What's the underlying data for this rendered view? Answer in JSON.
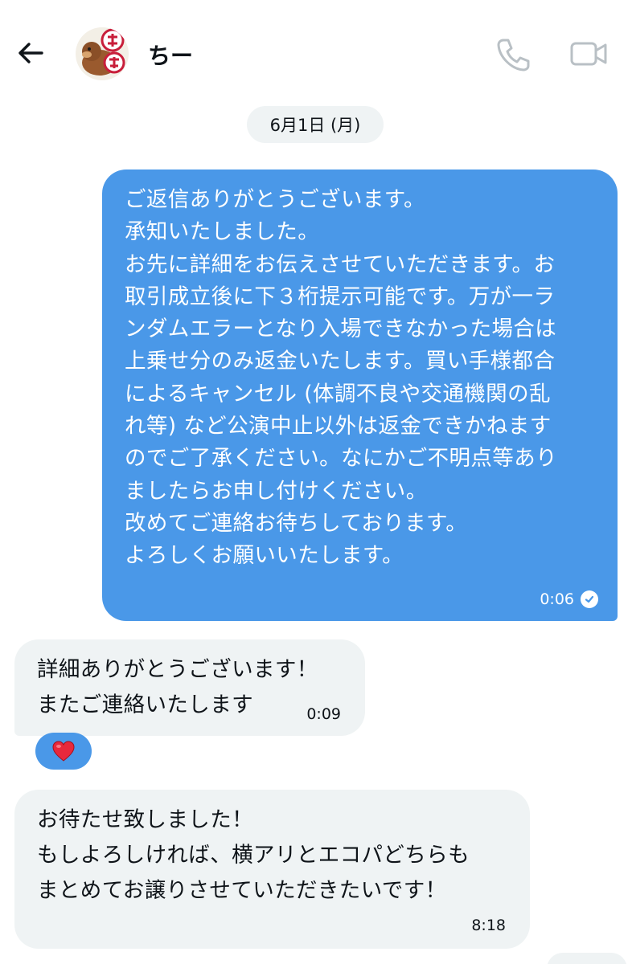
{
  "header": {
    "name": "ちー",
    "back_icon": "arrow-left-icon",
    "call_icon": "phone-icon",
    "video_icon": "video-camera-icon"
  },
  "date_separator": "6月1日 (月)",
  "messages": [
    {
      "direction": "outgoing",
      "text": "ご返信ありがとうございます。\n承知いたしました。\nお先に詳細をお伝えさせていただきます。お\n取引成立後に下３桁提示可能です。万が一ラ\nンダムエラーとなり入場できなかった場合は\n上乗せ分のみ返金いたします。買い手様都合\nによるキャンセル (体調不良や交通機関の乱\nれ等) など公演中止以外は返金できかねます\nのでご了承ください。なにかご不明点等あり\nましたらお申し付けください。\n改めてご連絡お待ちしております。\nよろしくお願いいたします。",
      "time": "0:06",
      "status_icon": "read-check-icon"
    },
    {
      "direction": "incoming",
      "text": "詳細ありがとうございます！\nまたご連絡いたします",
      "time": "0:09",
      "reaction": "❤️"
    },
    {
      "direction": "incoming",
      "text": "お待たせ致しました！\nもしよろしければ、横アリとエコパどちらも\nまとめてお譲りさせていただきたいです！",
      "time": "8:18"
    }
  ],
  "colors": {
    "outgoing_bubble": "#4a98e8",
    "incoming_bubble": "#eff3f4",
    "icon_gray": "#b9c0c5",
    "text": "#0f1419"
  }
}
